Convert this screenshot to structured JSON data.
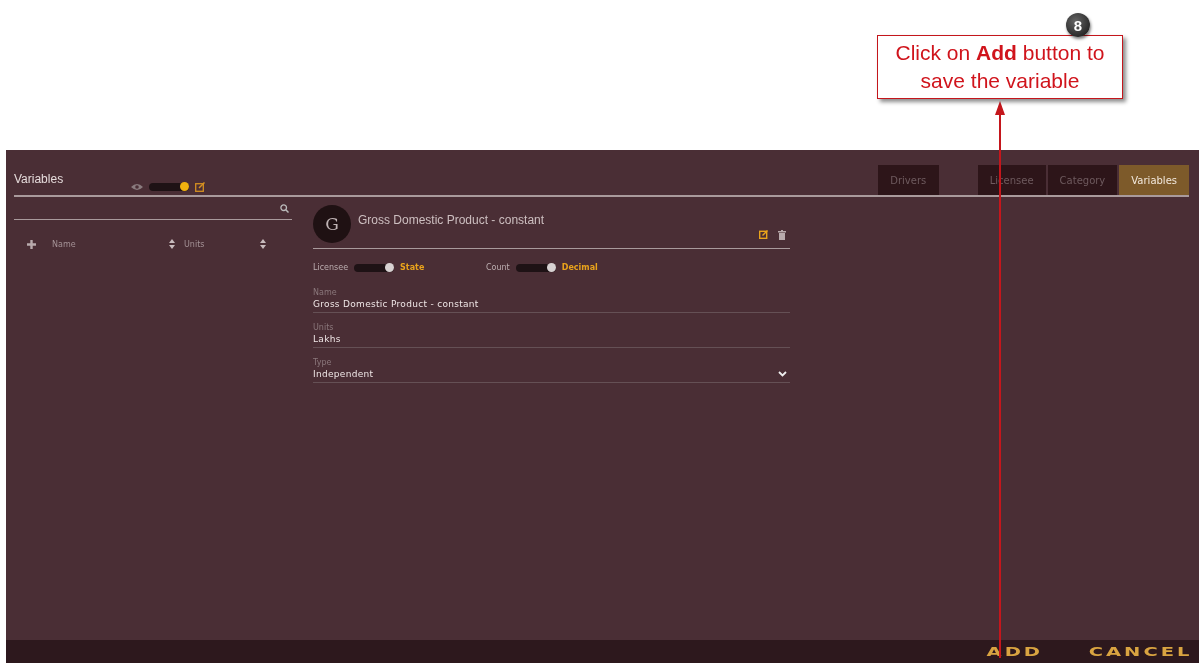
{
  "annotation": {
    "step": "8",
    "text": "Click on **Add** button to save the variable"
  },
  "panel": {
    "title": "Variables",
    "view_toggle": {
      "on": true
    }
  },
  "tabs": [
    {
      "label": "Drivers",
      "selected": false
    },
    {
      "label": "Licensee",
      "selected": false
    },
    {
      "label": "Category",
      "selected": false
    },
    {
      "label": "Variables",
      "selected": true
    }
  ],
  "list": {
    "columns": [
      "Name",
      "Units"
    ]
  },
  "detail": {
    "avatar": "G",
    "title": "Gross Domestic Product - constant",
    "switches": [
      {
        "label": "Licensee",
        "on": true,
        "value": "State"
      },
      {
        "label": "Count",
        "on": true,
        "value": "Decimal"
      }
    ],
    "fields": [
      {
        "kind": "text",
        "label": "Name",
        "value": "Gross Domestic Product - constant"
      },
      {
        "kind": "text",
        "label": "Units",
        "value": "Lakhs"
      },
      {
        "kind": "select",
        "label": "Type",
        "value": "Independent"
      }
    ]
  },
  "footer": {
    "buttons": [
      "ADD",
      "CANCEL"
    ]
  }
}
